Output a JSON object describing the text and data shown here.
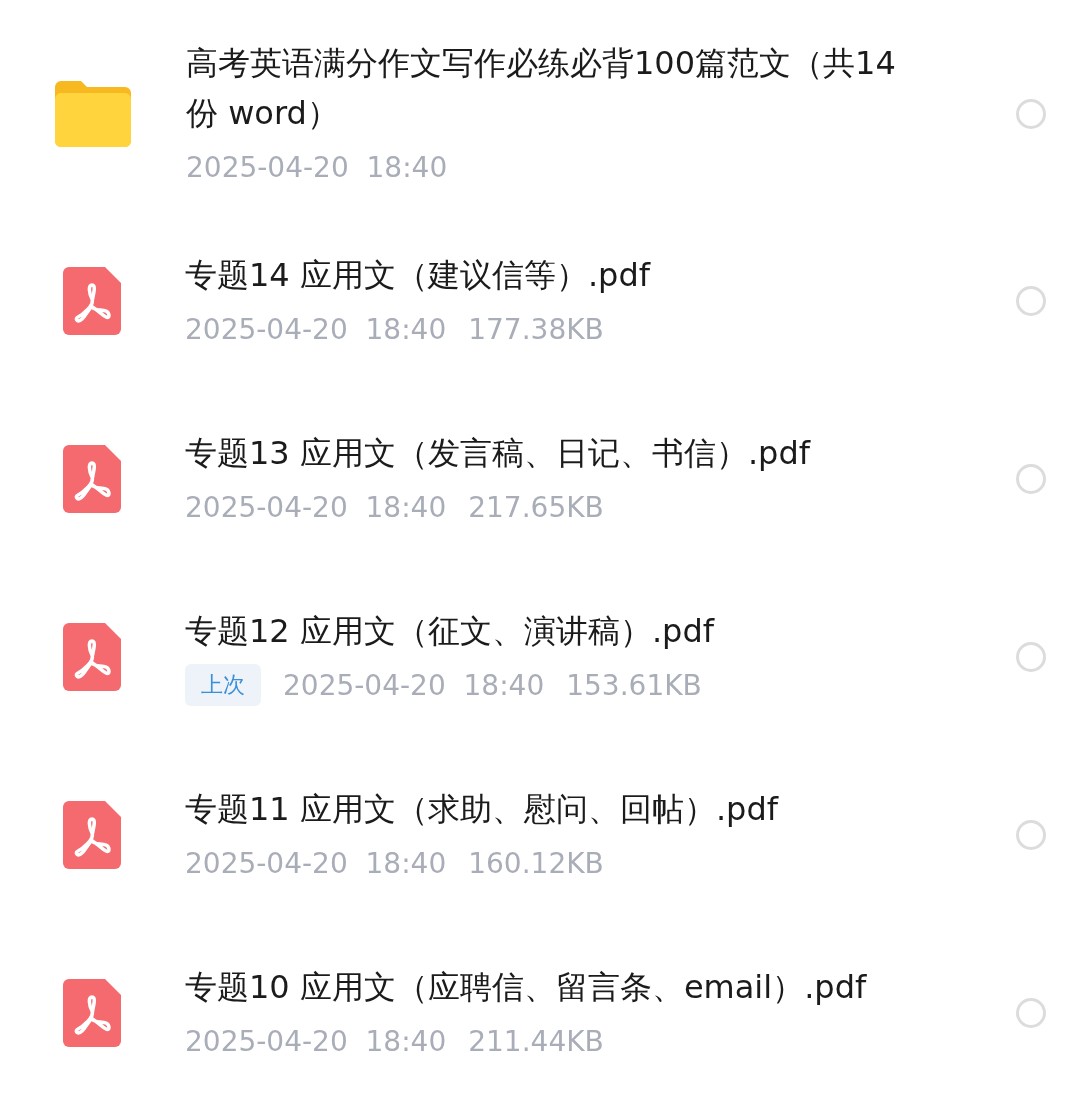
{
  "files": [
    {
      "kind": "folder",
      "name": "高考英语满分作文写作必练必背100篇范文（共14份 word）",
      "date": "2025-04-20  18:40",
      "selected": false
    },
    {
      "kind": "pdf",
      "name": "专题14 应用文（建议信等）.pdf",
      "date": "2025-04-20  18:40",
      "size": "177.38KB",
      "selected": false
    },
    {
      "kind": "pdf",
      "name": "专题13 应用文（发言稿、日记、书信）.pdf",
      "date": "2025-04-20  18:40",
      "size": "217.65KB",
      "selected": false
    },
    {
      "kind": "pdf",
      "name": "专题12 应用文（征文、演讲稿）.pdf",
      "tag": "上次",
      "date": "2025-04-20  18:40",
      "size": "153.61KB",
      "selected": false
    },
    {
      "kind": "pdf",
      "name": "专题11 应用文（求助、慰问、回帖）.pdf",
      "date": "2025-04-20  18:40",
      "size": "160.12KB",
      "selected": false
    },
    {
      "kind": "pdf",
      "name": "专题10 应用文（应聘信、留言条、email）.pdf",
      "date": "2025-04-20  18:40",
      "size": "211.44KB",
      "selected": false
    }
  ]
}
